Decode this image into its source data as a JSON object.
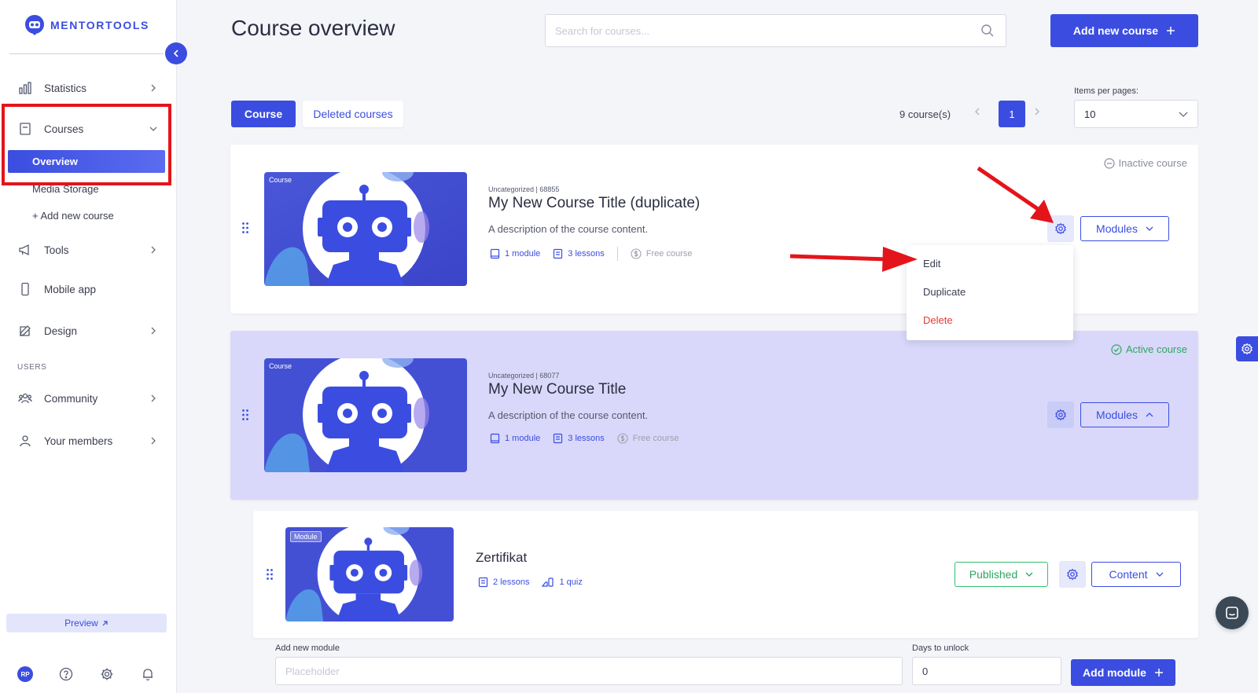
{
  "app": {
    "logo_text": "MENTORTOOLS"
  },
  "sidebar": {
    "items": [
      {
        "label": "Statistics"
      },
      {
        "label": "Courses"
      },
      {
        "label": "Tools"
      },
      {
        "label": "Mobile app"
      },
      {
        "label": "Design"
      },
      {
        "label": "Community"
      },
      {
        "label": "Your members"
      }
    ],
    "courses_sub": {
      "overview": "Overview",
      "media_storage": "Media Storage",
      "add_new_course": "+ Add new course"
    },
    "section_users": "USERS",
    "preview_label": "Preview",
    "avatar_initials": "RP"
  },
  "header": {
    "title": "Course overview",
    "search_placeholder": "Search for courses...",
    "add_course_label": "Add new course"
  },
  "tabs": {
    "course": "Course",
    "deleted": "Deleted courses"
  },
  "pagination": {
    "count": "9 course(s)",
    "current_page": "1",
    "items_per_page_label": "Items per pages:",
    "items_per_page_value": "10"
  },
  "courses": [
    {
      "tag": "Course",
      "meta": "Uncategorized | 68855",
      "title": "My New Course Title (duplicate)",
      "description": "A description of the course content.",
      "modules": "1 module",
      "lessons": "3 lessons",
      "price": "Free course",
      "status": "Inactive course",
      "modules_btn": "Modules"
    },
    {
      "tag": "Course",
      "meta": "Uncategorized | 68077",
      "title": "My New Course Title",
      "description": "A description of the course content.",
      "modules": "1 module",
      "lessons": "3 lessons",
      "price": "Free course",
      "status": "Active course",
      "modules_btn": "Modules"
    }
  ],
  "dropdown": {
    "edit": "Edit",
    "duplicate": "Duplicate",
    "delete": "Delete"
  },
  "module": {
    "tag": "Module",
    "title": "Zertifikat",
    "lessons": "2 lessons",
    "quiz": "1 quiz",
    "published_label": "Published",
    "content_label": "Content"
  },
  "add_module": {
    "label": "Add new module",
    "placeholder": "Placeholder",
    "days_label": "Days to unlock",
    "days_value": "0",
    "button_label": "Add module"
  },
  "colors": {
    "primary": "#3b4de0",
    "active_bg": "#d9d8fa",
    "success": "#34c06d",
    "danger": "#e53935",
    "annotation": "#e3151b"
  }
}
